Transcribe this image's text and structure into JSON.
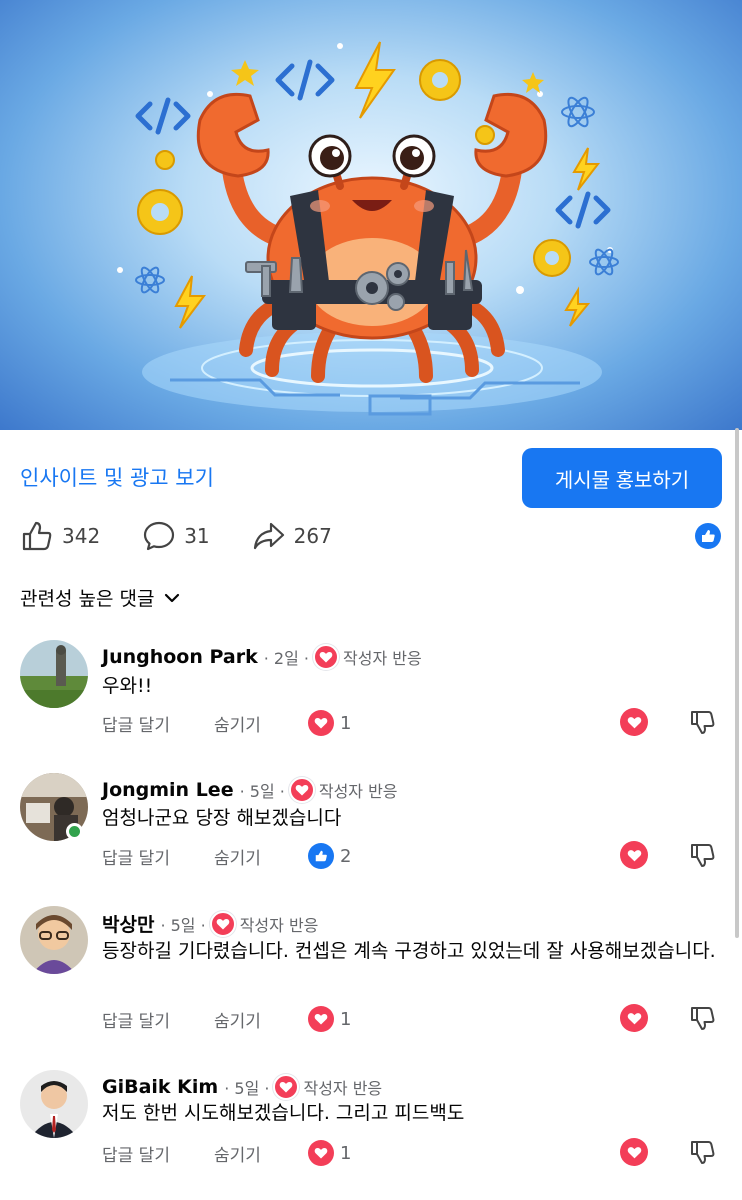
{
  "header": {
    "insights_link": "인사이트 및 광고 보기",
    "promote_button": "게시물 홍보하기"
  },
  "stats": {
    "likes": "342",
    "comments": "31",
    "shares": "267"
  },
  "sort_label": "관련성 높은 댓글",
  "labels": {
    "reply": "답글 달기",
    "hide": "숨기기",
    "author_reacted": "작성자 반응"
  },
  "comments": [
    {
      "author": "Junghoon Park",
      "time": "· 2일 ·",
      "text": "우와!!",
      "reaction": "heart",
      "reaction_count": "1"
    },
    {
      "author": "Jongmin Lee",
      "time": "· 5일 ·",
      "text": "엄청나군요 당장 해보겠습니다",
      "reaction": "like",
      "reaction_count": "2",
      "online": true
    },
    {
      "author": "박상만",
      "time": "· 5일 ·",
      "text": "등장하길 기다렸습니다. 컨셉은 계속 구경하고 있었는데 잘 사용해보겠습니다.",
      "reaction": "heart",
      "reaction_count": "1"
    },
    {
      "author": "GiBaik Kim",
      "time": "· 5일 ·",
      "text": "저도 한번 시도해보겠습니다. 그리고 피드백도",
      "reaction": "heart",
      "reaction_count": "1"
    }
  ],
  "colors": {
    "accent": "#1877f2",
    "heart": "#f33e58",
    "muted_text": "#65676b"
  }
}
